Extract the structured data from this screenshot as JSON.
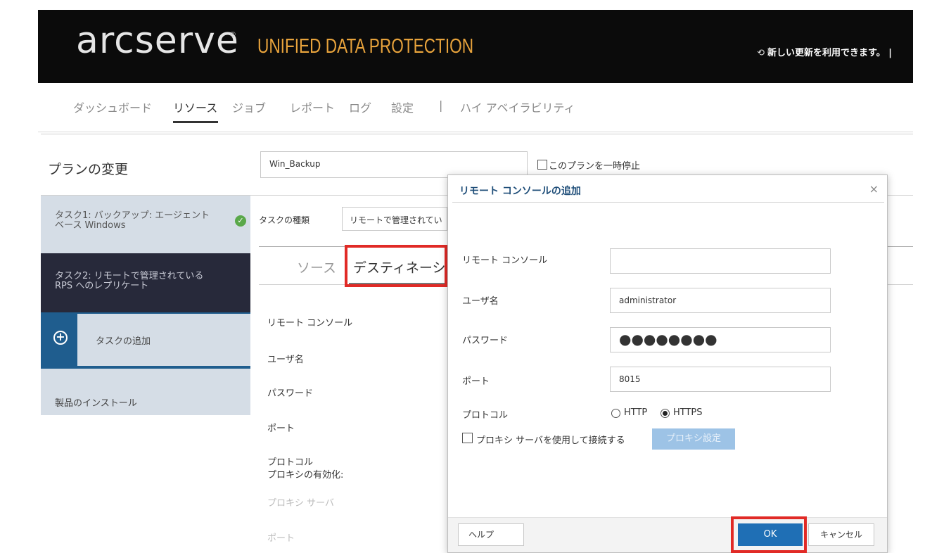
{
  "header": {
    "logo": "arcserve",
    "logo_reg": "®",
    "product": "UNIFIED DATA PROTECTION",
    "update_notice": "新しい更新を利用できます。 |"
  },
  "nav": {
    "items": [
      "ダッシュボード",
      "リソース",
      "ジョブ",
      "レポート",
      "ログ",
      "設定",
      "|",
      "ハイ アベイラビリティ"
    ],
    "active": "リソース"
  },
  "plan": {
    "title": "プランの変更",
    "name": "Win_Backup",
    "pause_label": "このプランを一時停止"
  },
  "sidebar": {
    "task1_line1": "タスク1: バックアップ: エージェント",
    "task1_line2": "ベース Windows",
    "task1_check": "✓",
    "task2_line1": "タスク2: リモートで管理されている",
    "task2_line2": "RPS へのレプリケート",
    "add_task": "タスクの追加",
    "add_icon": "+",
    "install": "製品のインストール"
  },
  "main": {
    "task_type_label": "タスクの種類",
    "task_type_value": "リモートで管理されてい",
    "tab_source": "ソース",
    "tab_destination": "デスティネーション",
    "fields": {
      "remote_console": "リモート コンソール",
      "username": "ユーザ名",
      "password": "パスワード",
      "port": "ポート",
      "protocol": "プロトコル",
      "proxy_enabled": "プロキシの有効化:",
      "proxy_server": "プロキシ サーバ",
      "port2": "ポート"
    }
  },
  "dialog": {
    "title": "リモート コンソールの追加",
    "close": "×",
    "remote_console_label": "リモート コンソール",
    "remote_console_value": "",
    "username_label": "ユーザ名",
    "username_value": "administrator",
    "password_label": "パスワード",
    "password_value": "●●●●●●●●",
    "port_label": "ポート",
    "port_value": "8015",
    "protocol_label": "プロトコル",
    "protocol_options": [
      "HTTP",
      "HTTPS"
    ],
    "protocol_selected": "HTTPS",
    "proxy_check_label": "プロキシ サーバを使用して接続する",
    "proxy_button": "プロキシ設定",
    "help_button": "ヘルプ",
    "ok_button": "OK",
    "cancel_button": "キャンセル"
  },
  "colors": {
    "header_bg": "#0b0b0b",
    "product_orange": "#e8a33c",
    "highlight_red": "#e12a26",
    "ok_blue": "#1f6fb5",
    "task_dark": "#27293a",
    "task_add_blue": "#1f5d8e"
  }
}
